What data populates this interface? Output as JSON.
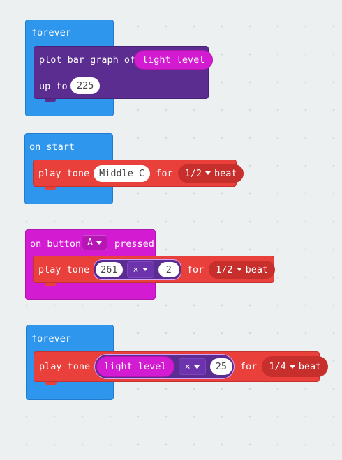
{
  "stack1": {
    "hat_label": "forever",
    "block": {
      "line1": "plot bar graph of",
      "reporter": "light level",
      "line2": "up to",
      "value": "225"
    }
  },
  "stack2": {
    "hat_label": "on start",
    "block": {
      "label": "play tone",
      "note": "Middle C",
      "for_label": "for",
      "beat_value": "1/2",
      "beat_label": "beat"
    }
  },
  "stack3": {
    "hat_label_before": "on button",
    "button_value": "A",
    "hat_label_after": "pressed",
    "block": {
      "label": "play tone",
      "left_operand": "261",
      "operator": "×",
      "right_operand": "2",
      "for_label": "for",
      "beat_value": "1/2",
      "beat_label": "beat"
    }
  },
  "stack4": {
    "hat_label": "forever",
    "block": {
      "label": "play tone",
      "reporter": "light level",
      "operator": "×",
      "right_operand": "25",
      "for_label": "for",
      "beat_value": "1/4",
      "beat_label": "beat"
    }
  },
  "colors": {
    "workspace": "#ecf0f1",
    "basic_blue": "#2f96ed",
    "music_red": "#e9403c",
    "led_purple": "#5c2d91",
    "input_magenta": "#d31cd1",
    "math_purple": "#6c33ad"
  }
}
